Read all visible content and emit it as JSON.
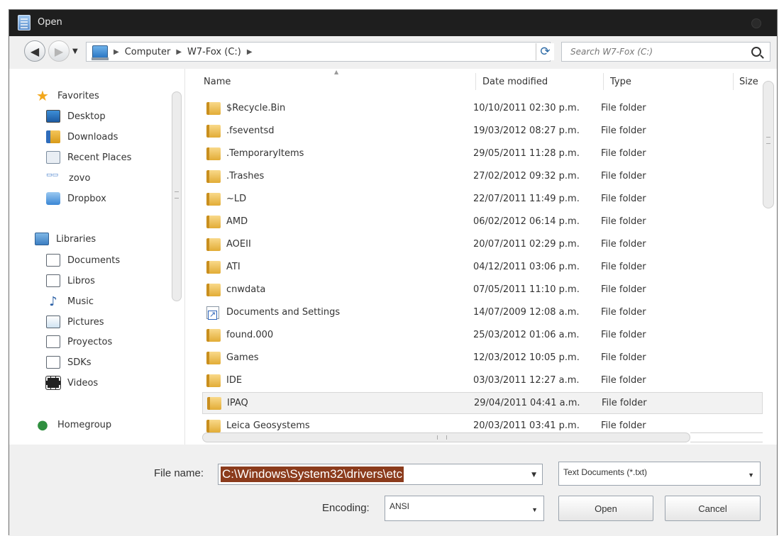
{
  "window": {
    "title": "Open"
  },
  "nav": {
    "breadcrumbs": [
      "Computer",
      "W7-Fox (C:)"
    ],
    "search_placeholder": "Search W7-Fox (C:)"
  },
  "sidebar": {
    "favorites_label": "Favorites",
    "favorites": [
      "Desktop",
      "Downloads",
      "Recent Places",
      "zovo",
      "Dropbox"
    ],
    "libraries_label": "Libraries",
    "libraries": [
      "Documents",
      "Libros",
      "Music",
      "Pictures",
      "Proyectos",
      "SDKs",
      "Videos"
    ],
    "homegroup_label": "Homegroup"
  },
  "columns": {
    "name": "Name",
    "date": "Date modified",
    "type": "Type",
    "size": "Size"
  },
  "files": [
    {
      "name": "$Recycle.Bin",
      "date": "10/10/2011 02:30 p.m.",
      "type": "File folder",
      "icon": "folder-icon"
    },
    {
      "name": ".fseventsd",
      "date": "19/03/2012 08:27 p.m.",
      "type": "File folder",
      "icon": "folder-icon"
    },
    {
      "name": ".TemporaryItems",
      "date": "29/05/2011 11:28 p.m.",
      "type": "File folder",
      "icon": "folder-icon"
    },
    {
      "name": ".Trashes",
      "date": "27/02/2012 09:32 p.m.",
      "type": "File folder",
      "icon": "folder-icon"
    },
    {
      "name": "~LD",
      "date": "22/07/2011 11:49 p.m.",
      "type": "File folder",
      "icon": "folder-icon"
    },
    {
      "name": "AMD",
      "date": "06/02/2012 06:14 p.m.",
      "type": "File folder",
      "icon": "folder-icon"
    },
    {
      "name": "AOEII",
      "date": "20/07/2011 02:29 p.m.",
      "type": "File folder",
      "icon": "folder-icon"
    },
    {
      "name": "ATI",
      "date": "04/12/2011 03:06 p.m.",
      "type": "File folder",
      "icon": "folder-icon"
    },
    {
      "name": "cnwdata",
      "date": "07/05/2011 11:10 p.m.",
      "type": "File folder",
      "icon": "folder-icon"
    },
    {
      "name": "Documents and Settings",
      "date": "14/07/2009 12:08 a.m.",
      "type": "File folder",
      "icon": "shortcut-icon"
    },
    {
      "name": "found.000",
      "date": "25/03/2012 01:06 a.m.",
      "type": "File folder",
      "icon": "folder-icon"
    },
    {
      "name": "Games",
      "date": "12/03/2012 10:05 p.m.",
      "type": "File folder",
      "icon": "folder-icon"
    },
    {
      "name": "IDE",
      "date": "03/03/2011 12:27 a.m.",
      "type": "File folder",
      "icon": "folder-icon"
    },
    {
      "name": "IPAQ",
      "date": "29/04/2011 04:41 a.m.",
      "type": "File folder",
      "icon": "folder-icon",
      "selected": true
    },
    {
      "name": "Leica Geosystems",
      "date": "20/03/2011 03:41 p.m.",
      "type": "File folder",
      "icon": "folder-icon"
    }
  ],
  "footer": {
    "filename_label": "File name:",
    "filename_value": "C:\\Windows\\System32\\drivers\\etc",
    "filter_value": "Text Documents (*.txt)",
    "encoding_label": "Encoding:",
    "encoding_value": "ANSI",
    "open_label": "Open",
    "cancel_label": "Cancel"
  },
  "colors": {
    "titlebar": "#1e1e1e",
    "selection": "#8b3b1c",
    "folder": "#e2ac36"
  }
}
